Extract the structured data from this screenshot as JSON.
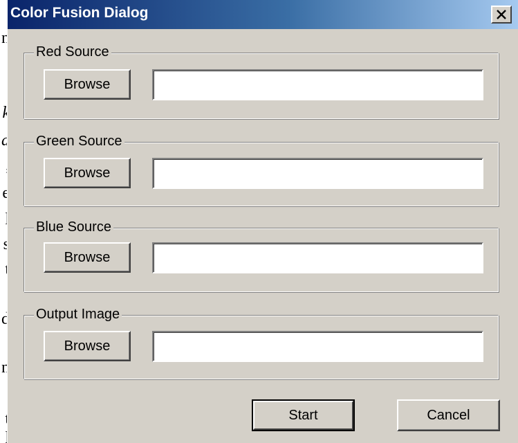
{
  "background_doc": {
    "chars": [
      {
        "text": "n",
        "italic": false
      },
      {
        "text": "k",
        "italic": true
      },
      {
        "text": "a",
        "italic": true
      },
      {
        "text": ",",
        "italic": false
      },
      {
        "text": "e",
        "italic": false
      },
      {
        "text": "l",
        "italic": false
      },
      {
        "text": "s",
        "italic": false
      },
      {
        "text": "t",
        "italic": false
      },
      {
        "text": "d",
        "italic": false
      },
      {
        "text": "n",
        "italic": false
      },
      {
        "text": "t",
        "italic": false
      },
      {
        "text": "l",
        "italic": false
      }
    ]
  },
  "dialog": {
    "title": "Color Fusion Dialog",
    "close_icon": "close-x-icon",
    "groups": [
      {
        "label": "Red Source",
        "browse_label": "Browse",
        "path_value": ""
      },
      {
        "label": "Green Source",
        "browse_label": "Browse",
        "path_value": ""
      },
      {
        "label": "Blue Source",
        "browse_label": "Browse",
        "path_value": ""
      },
      {
        "label": "Output Image",
        "browse_label": "Browse",
        "path_value": ""
      }
    ],
    "start_label": "Start",
    "cancel_label": "Cancel"
  },
  "colors": {
    "title_gradient_start": "#0a246a",
    "title_gradient_end": "#a6caf0",
    "dialog_face": "#d4d0c8"
  }
}
